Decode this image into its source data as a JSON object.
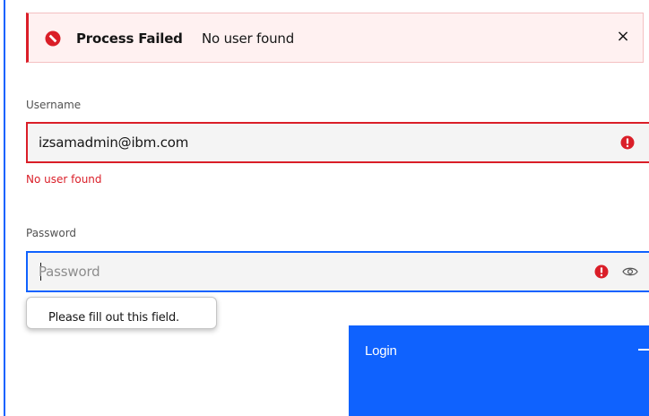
{
  "notification": {
    "title": "Process Failed",
    "subtitle": "No user found",
    "close_label": "×",
    "kind": "error",
    "accent_color": "#da1e28"
  },
  "username": {
    "label": "Username",
    "value": "izsamadmin@ibm.com",
    "error_text": "No user found",
    "icon": "warning-filled-icon"
  },
  "password": {
    "label": "Password",
    "placeholder": "Password",
    "value": "",
    "icons": [
      "warning-filled-icon",
      "eye-icon"
    ]
  },
  "validation_tooltip": {
    "text": "Please fill out this field."
  },
  "login_button": {
    "label": "Login",
    "color": "#0f62fe"
  }
}
